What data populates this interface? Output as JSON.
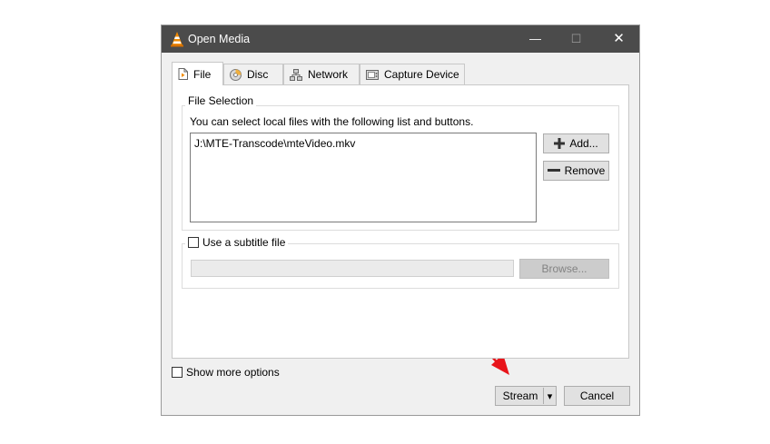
{
  "window": {
    "title": "Open Media",
    "controls": {
      "minimize": "—",
      "maximize": "☐",
      "close": "✕"
    }
  },
  "tabs": [
    {
      "label": "File",
      "icon": "file-icon"
    },
    {
      "label": "Disc",
      "icon": "disc-icon"
    },
    {
      "label": "Network",
      "icon": "network-icon"
    },
    {
      "label": "Capture Device",
      "icon": "capture-device-icon"
    }
  ],
  "file_selection": {
    "group_title": "File Selection",
    "instructions": "You can select local files with the following list and buttons.",
    "files": [
      "J:\\MTE-Transcode\\mteVideo.mkv"
    ],
    "add_label": "Add...",
    "remove_label": "Remove"
  },
  "subtitle": {
    "checkbox_label": "Use a subtitle file",
    "checked": false,
    "path_value": "",
    "browse_label": "Browse..."
  },
  "footer": {
    "show_more_label": "Show more options",
    "show_more_checked": false,
    "stream_label": "Stream",
    "dropdown_icon": "▾",
    "cancel_label": "Cancel"
  },
  "annotation": {
    "arrow_color": "#e8141a"
  }
}
